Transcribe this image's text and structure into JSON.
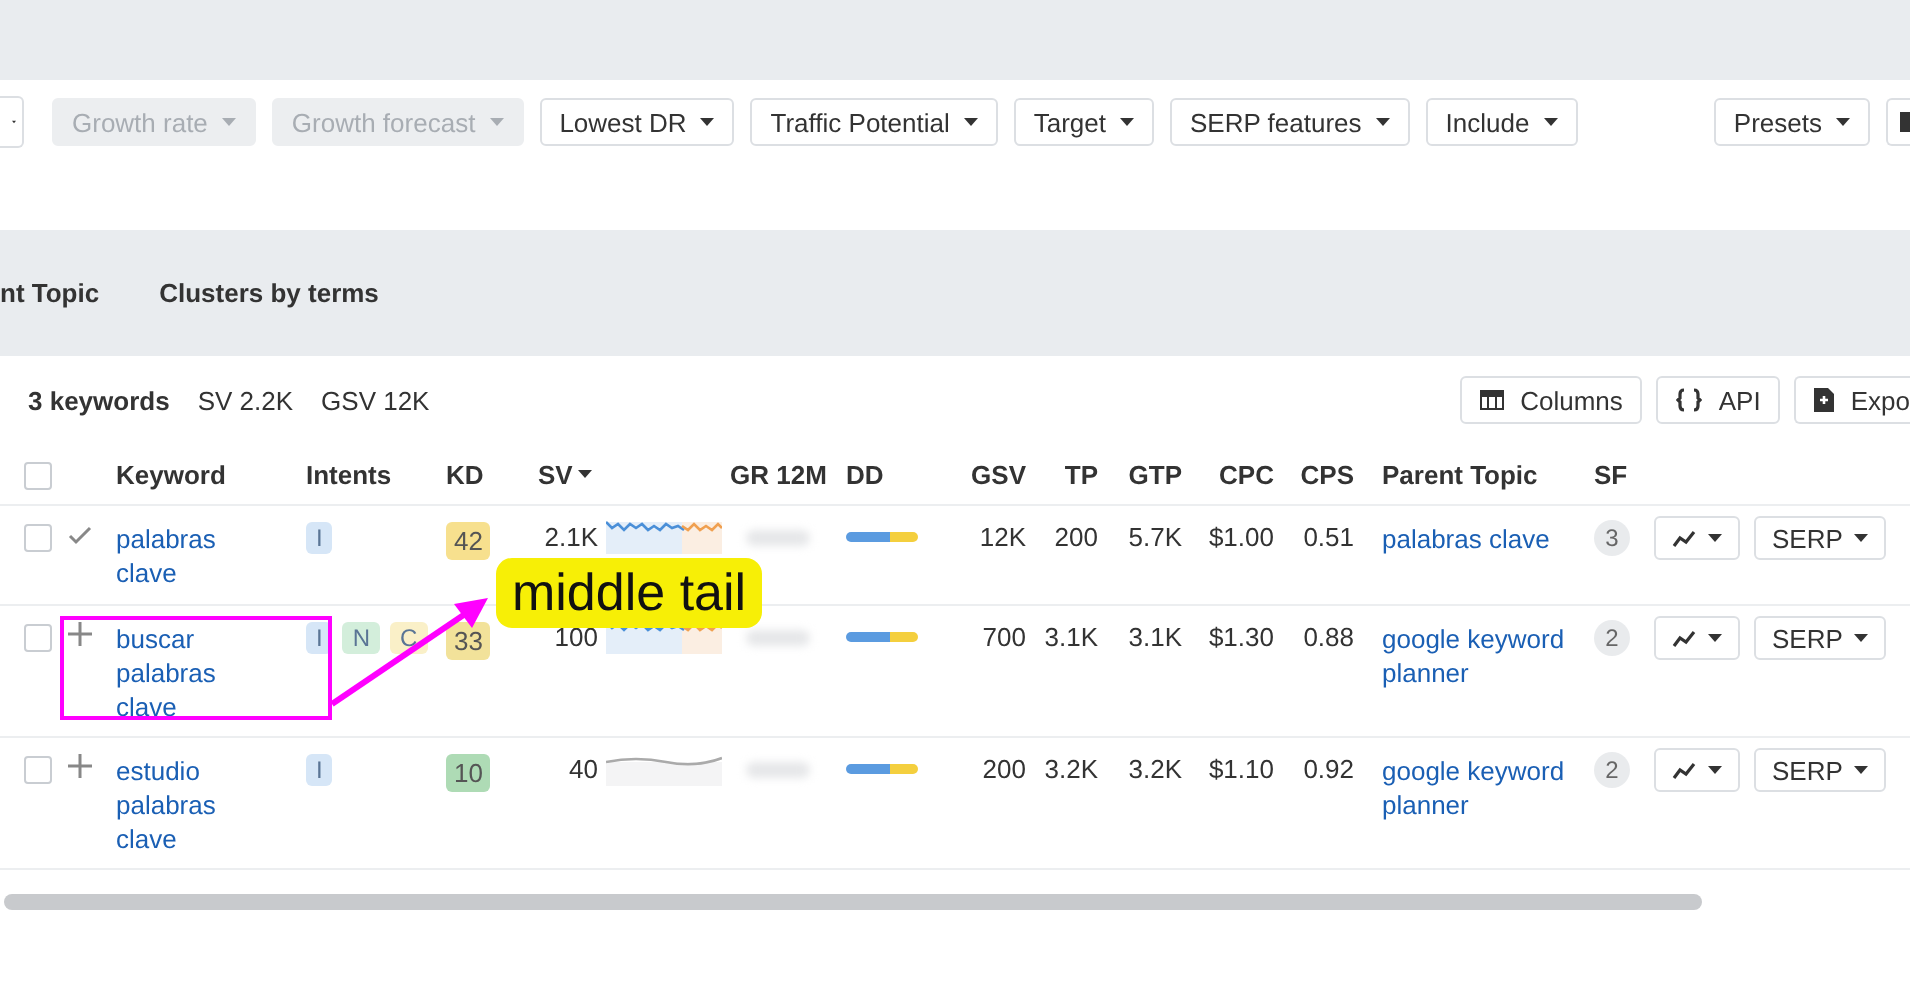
{
  "filters": [
    {
      "label": "Growth rate",
      "disabled": true
    },
    {
      "label": "Growth forecast",
      "disabled": true
    },
    {
      "label": "Lowest DR",
      "disabled": false
    },
    {
      "label": "Traffic Potential",
      "disabled": false
    },
    {
      "label": "Target",
      "disabled": false
    },
    {
      "label": "SERP features",
      "disabled": false
    },
    {
      "label": "Include",
      "disabled": false
    }
  ],
  "presets": {
    "label": "Presets"
  },
  "tabs": [
    {
      "label": "nt Topic",
      "selected": false
    },
    {
      "label": "Clusters by terms",
      "selected": false
    }
  ],
  "summary": {
    "count": "3 keywords",
    "sv": "SV 2.2K",
    "gsv": "GSV 12K"
  },
  "actions": [
    {
      "label": "Columns",
      "kind": "columns"
    },
    {
      "label": "API",
      "kind": "api"
    },
    {
      "label": "Expo",
      "kind": "export"
    }
  ],
  "select_all_checked": false,
  "columns": [
    "Keyword",
    "Intents",
    "KD",
    "SV",
    "GR 12M",
    "DD",
    "GSV",
    "TP",
    "GTP",
    "CPC",
    "CPS",
    "Parent Topic",
    "SF"
  ],
  "rows": [
    {
      "checked": false,
      "added": true,
      "keyword": "palabras clave",
      "intents": [
        {
          "label": "I",
          "color": "#d6e6f7"
        }
      ],
      "kd": {
        "value": "42",
        "color": "#f7e08e"
      },
      "sv": "2.1K",
      "trend": {
        "kind": "volatile"
      },
      "gsv": "12K",
      "tp": "200",
      "gtp": "5.7K",
      "cpc": "$1.00",
      "cps": "0.51",
      "parent": "palabras clave",
      "sf": "3",
      "serp": "SERP"
    },
    {
      "checked": false,
      "added": false,
      "keyword": "buscar palabras clave",
      "intents": [
        {
          "label": "I",
          "color": "#d6e6f7"
        },
        {
          "label": "N",
          "color": "#d3eedb"
        },
        {
          "label": "C",
          "color": "#faf0c8"
        }
      ],
      "kd": {
        "value": "33",
        "color": "#f2e29a"
      },
      "sv": "100",
      "trend": {
        "kind": "volatile"
      },
      "gsv": "700",
      "tp": "3.1K",
      "gtp": "3.1K",
      "cpc": "$1.30",
      "cps": "0.88",
      "parent": "google keyword planner",
      "sf": "2",
      "serp": "SERP"
    },
    {
      "checked": false,
      "added": false,
      "keyword": "estudio palabras clave",
      "intents": [
        {
          "label": "I",
          "color": "#d6e6f7"
        }
      ],
      "kd": {
        "value": "10",
        "color": "#aedbb5"
      },
      "sv": "40",
      "trend": {
        "kind": "flat"
      },
      "gsv": "200",
      "tp": "3.2K",
      "gtp": "3.2K",
      "cpc": "$1.10",
      "cps": "0.92",
      "parent": "google keyword planner",
      "sf": "2",
      "serp": "SERP"
    }
  ],
  "annotation": {
    "label": "middle tail"
  }
}
